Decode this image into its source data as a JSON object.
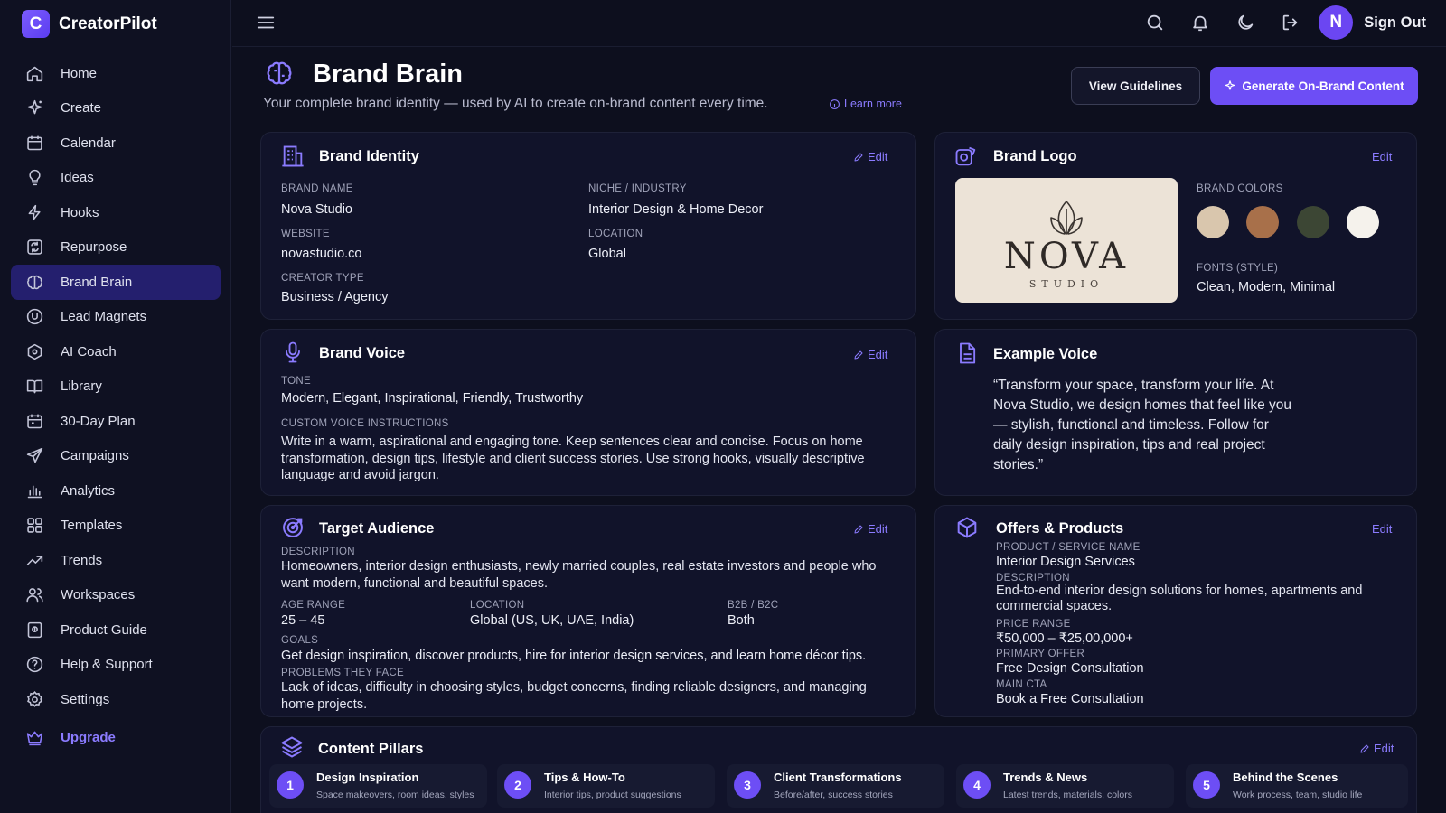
{
  "app": {
    "name": "CreatorPilot",
    "logo_letter": "C"
  },
  "sidebar": {
    "items": [
      {
        "label": "Home",
        "icon": "home-icon"
      },
      {
        "label": "Create",
        "icon": "sparkle-icon"
      },
      {
        "label": "Calendar",
        "icon": "calendar-icon"
      },
      {
        "label": "Ideas",
        "icon": "lightbulb-icon"
      },
      {
        "label": "Hooks",
        "icon": "hook-icon"
      },
      {
        "label": "Repurpose",
        "icon": "repurpose-icon"
      },
      {
        "label": "Brand Brain",
        "icon": "brain-icon"
      },
      {
        "label": "Lead Magnets",
        "icon": "magnet-icon"
      },
      {
        "label": "AI Coach",
        "icon": "coach-icon"
      },
      {
        "label": "Library",
        "icon": "book-icon"
      },
      {
        "label": "30-Day Plan",
        "icon": "plan-calendar-icon"
      },
      {
        "label": "Campaigns",
        "icon": "send-icon"
      },
      {
        "label": "Analytics",
        "icon": "bar-chart-icon"
      },
      {
        "label": "Templates",
        "icon": "templates-icon"
      },
      {
        "label": "Trends",
        "icon": "trend-icon"
      },
      {
        "label": "Workspaces",
        "icon": "users-icon"
      },
      {
        "label": "Product Guide",
        "icon": "guide-icon"
      },
      {
        "label": "Help & Support",
        "icon": "help-icon"
      },
      {
        "label": "Settings",
        "icon": "gear-icon"
      }
    ],
    "active": "Brand Brain",
    "upgrade_label": "Upgrade"
  },
  "topbar": {
    "avatar_letter": "N",
    "sign_out": "Sign Out"
  },
  "header": {
    "title": "Brand Brain",
    "subtitle": "Your complete brand identity — used by AI to create on-brand content every time.",
    "learn_more": "Learn more",
    "view_guidelines": "View Guidelines",
    "generate": "Generate On-Brand Content"
  },
  "edit_label": "Edit",
  "brand_identity": {
    "title": "Brand Identity",
    "brand_name_label": "BRAND NAME",
    "brand_name": "Nova Studio",
    "niche_label": "NICHE / INDUSTRY",
    "niche": "Interior Design & Home Decor",
    "website_label": "WEBSITE",
    "website": "novastudio.co",
    "location_label": "LOCATION",
    "location": "Global",
    "creator_type_label": "CREATOR TYPE",
    "creator_type": "Business / Agency"
  },
  "brand_logo": {
    "title": "Brand Logo",
    "logo_text": "NOVA",
    "logo_sub": "STUDIO",
    "colors_label": "BRAND COLORS",
    "colors": [
      "#d9c6ad",
      "#a8704a",
      "#3c4634",
      "#f5f2ec"
    ],
    "fonts_label": "FONTS (STYLE)",
    "fonts": "Clean, Modern, Minimal"
  },
  "brand_voice": {
    "title": "Brand Voice",
    "tone_label": "TONE",
    "tone": "Modern, Elegant, Inspirational, Friendly, Trustworthy",
    "custom_label": "CUSTOM VOICE INSTRUCTIONS",
    "custom": "Write in a warm, aspirational and engaging tone. Keep sentences clear and concise. Focus on home transformation, design tips, lifestyle and client success stories. Use strong hooks, visually descriptive language and avoid jargon."
  },
  "example_voice": {
    "title": "Example Voice",
    "text": "“Transform your space, transform your life. At Nova Studio, we design homes that feel like you — stylish, functional and timeless. Follow for daily design inspiration, tips and real project stories.”"
  },
  "target_audience": {
    "title": "Target Audience",
    "description_label": "DESCRIPTION",
    "description": "Homeowners, interior design enthusiasts, newly married couples, real estate investors and people who want modern, functional and beautiful spaces.",
    "age_label": "AGE RANGE",
    "age": "25 – 45",
    "location_label": "LOCATION",
    "location": "Global (US, UK, UAE, India)",
    "b2b_label": "B2B / B2C",
    "b2b": "Both",
    "goals_label": "GOALS",
    "goals": "Get design inspiration, discover products, hire for interior design services, and learn home décor tips.",
    "problems_label": "PROBLEMS THEY FACE",
    "problems": "Lack of ideas, difficulty in choosing styles, budget concerns, finding reliable designers, and managing home projects."
  },
  "offers": {
    "title": "Offers & Products",
    "product_label": "PRODUCT / SERVICE NAME",
    "product": "Interior Design Services",
    "description_label": "DESCRIPTION",
    "description": "End-to-end interior design solutions for homes, apartments and commercial spaces.",
    "price_label": "PRICE RANGE",
    "price": "₹50,000 – ₹25,00,000+",
    "offer_label": "PRIMARY OFFER",
    "offer": "Free Design Consultation",
    "cta_label": "MAIN CTA",
    "cta": "Book a Free Consultation"
  },
  "pillars": {
    "title": "Content Pillars",
    "items": [
      {
        "num": "1",
        "title": "Design Inspiration",
        "sub": "Space makeovers, room ideas, styles"
      },
      {
        "num": "2",
        "title": "Tips & How-To",
        "sub": "Interior tips, product suggestions"
      },
      {
        "num": "3",
        "title": "Client Transformations",
        "sub": "Before/after, success stories"
      },
      {
        "num": "4",
        "title": "Trends & News",
        "sub": "Latest trends, materials, colors"
      },
      {
        "num": "5",
        "title": "Behind the Scenes",
        "sub": "Work process, team, studio life"
      }
    ]
  }
}
